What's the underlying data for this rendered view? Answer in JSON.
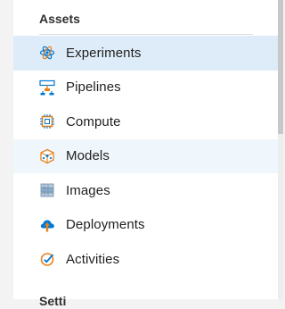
{
  "sidebar": {
    "section_title": "Assets",
    "next_section_title": "Setti",
    "items": [
      {
        "label": "Experiments",
        "icon": "flask-atom-icon",
        "state": "selected"
      },
      {
        "label": "Pipelines",
        "icon": "pipeline-icon",
        "state": "normal"
      },
      {
        "label": "Compute",
        "icon": "chip-icon",
        "state": "normal"
      },
      {
        "label": "Models",
        "icon": "model-cube-icon",
        "state": "hover"
      },
      {
        "label": "Images",
        "icon": "images-stack-icon",
        "state": "normal"
      },
      {
        "label": "Deployments",
        "icon": "cloud-upload-icon",
        "state": "normal"
      },
      {
        "label": "Activities",
        "icon": "activity-check-icon",
        "state": "normal"
      }
    ]
  },
  "colors": {
    "selected_bg": "#deecf9",
    "hover_bg": "#eff6fc",
    "accent_blue": "#0078d4",
    "accent_orange": "#e8811a",
    "text": "#201f1e"
  }
}
